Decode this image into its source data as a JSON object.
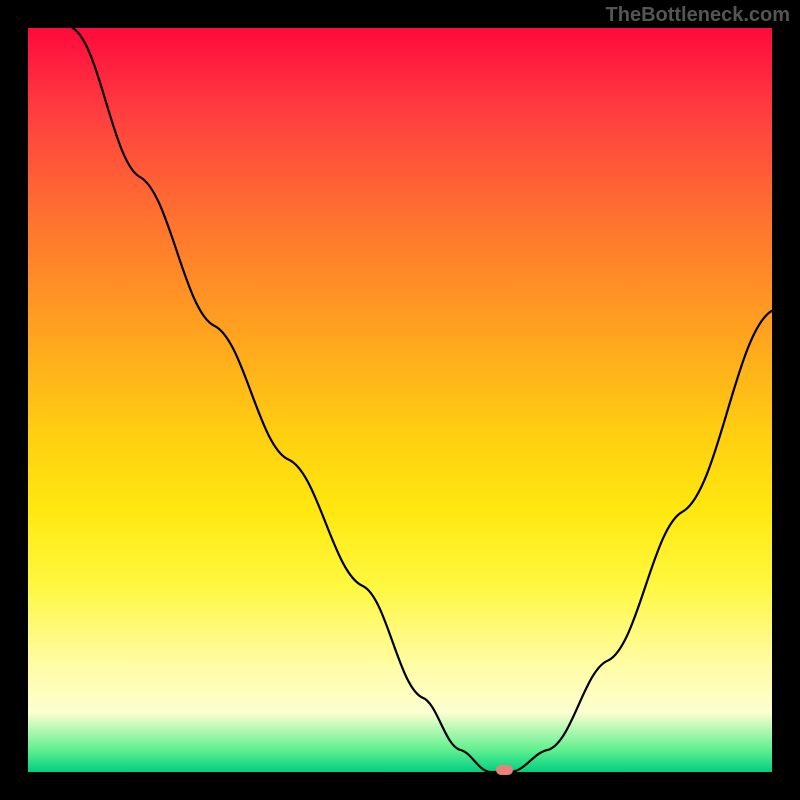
{
  "watermark": "TheBottleneck.com",
  "chart_data": {
    "type": "line",
    "title": "",
    "xlabel": "",
    "ylabel": "",
    "xlim": [
      0,
      100
    ],
    "ylim": [
      0,
      100
    ],
    "series": [
      {
        "name": "bottleneck-curve",
        "x": [
          6,
          15,
          25,
          35,
          45,
          53,
          58,
          62,
          65,
          70,
          78,
          88,
          100
        ],
        "y": [
          100,
          80,
          60,
          42,
          25,
          10,
          3,
          0,
          0,
          3,
          15,
          35,
          62
        ]
      }
    ],
    "marker": {
      "x": 64,
      "y": 0
    },
    "gradient_stops": [
      {
        "pos": 0,
        "color": "#ff0a3c"
      },
      {
        "pos": 25,
        "color": "#ff7030"
      },
      {
        "pos": 55,
        "color": "#ffd010"
      },
      {
        "pos": 85,
        "color": "#fffca0"
      },
      {
        "pos": 100,
        "color": "#00d080"
      }
    ]
  }
}
